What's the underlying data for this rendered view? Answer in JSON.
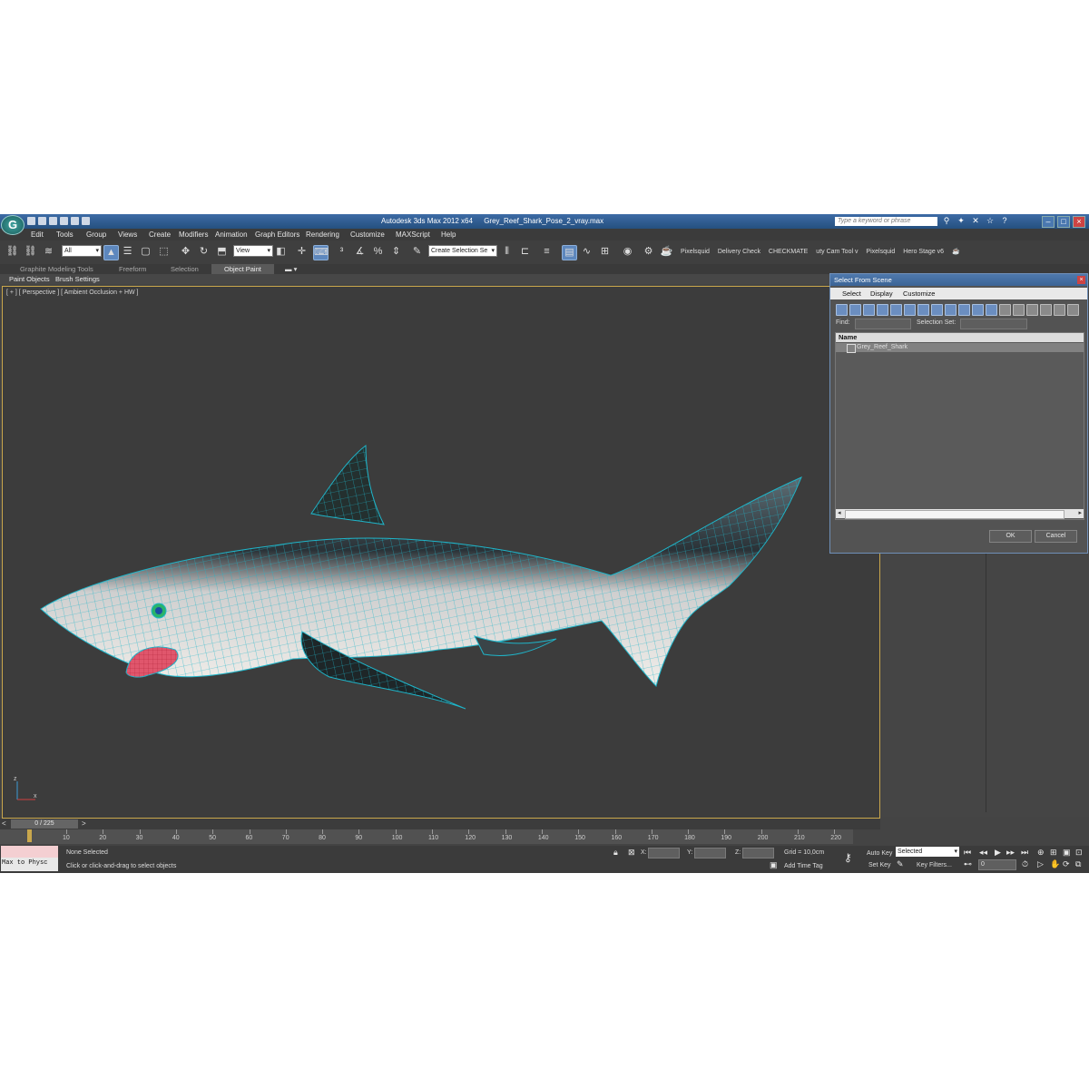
{
  "window": {
    "app_name": "Autodesk 3ds Max  2012 x64",
    "file_name": "Grey_Reef_Shark_Pose_2_vray.max",
    "search_placeholder": "Type a keyword or phrase"
  },
  "menu": [
    "Edit",
    "Tools",
    "Group",
    "Views",
    "Create",
    "Modifiers",
    "Animation",
    "Graph Editors",
    "Rendering",
    "Customize",
    "MAXScript",
    "Help"
  ],
  "toolbar": {
    "filter_value": "All",
    "ref_coord_value": "View",
    "selection_set_value": "Create Selection Se",
    "plugins": [
      "Pixelsquid",
      "Delivery Check",
      "CHECKMATE",
      "uty Cam Tool v",
      "Pixelsquid",
      "Hero Stage v6"
    ]
  },
  "ribbon": {
    "tabs": [
      "Graphite Modeling Tools",
      "Freeform",
      "Selection",
      "Object Paint"
    ],
    "active_tab": "Object Paint",
    "sub_items": [
      "Paint Objects",
      "Brush Settings"
    ]
  },
  "viewport": {
    "label": "[ + ] [ Perspective ] [ Ambient Occlusion + HW ]",
    "axis_x": "x",
    "axis_z": "z"
  },
  "dialog": {
    "title": "Select From Scene",
    "menu": [
      "Select",
      "Display",
      "Customize"
    ],
    "find_label": "Find:",
    "selection_set_label": "Selection Set:",
    "column_header": "Name",
    "rows": [
      "Grey_Reef_Shark"
    ],
    "ok_label": "OK",
    "cancel_label": "Cancel"
  },
  "timeline": {
    "frame_display": "0 / 225",
    "prev_arrow": "<",
    "next_arrow": ">",
    "ticks": [
      "10",
      "20",
      "30",
      "40",
      "50",
      "60",
      "70",
      "80",
      "90",
      "100",
      "110",
      "120",
      "130",
      "140",
      "150",
      "160",
      "170",
      "180",
      "190",
      "200",
      "210",
      "220"
    ]
  },
  "status": {
    "maxscript_label": "Max to Physc",
    "selection_text": "None Selected",
    "prompt_text": "Click or click-and-drag to select objects",
    "x_label": "X:",
    "y_label": "Y:",
    "z_label": "Z:",
    "grid_text": "Grid = 10,0cm",
    "add_time_tag": "Add Time Tag",
    "auto_key": "Auto Key",
    "set_key": "Set Key",
    "key_mode_value": "Selected",
    "key_filters": "Key Filters...",
    "current_frame": "0"
  },
  "colors": {
    "accent": "#5d87bd",
    "viewport_border": "#c9a74c",
    "wire": "#1fb5c9",
    "mouth": "#e0566c"
  }
}
